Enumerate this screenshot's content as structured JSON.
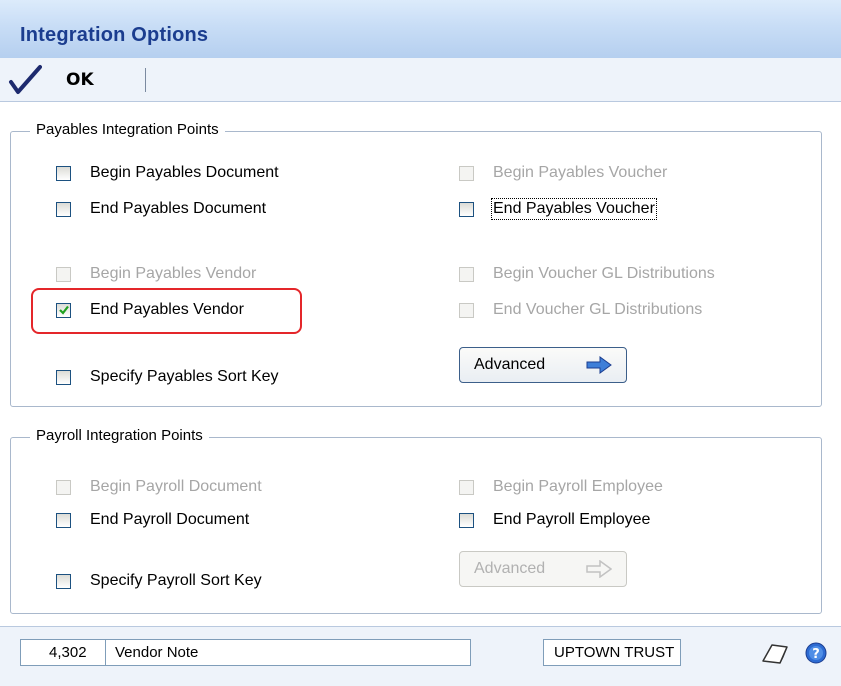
{
  "window": {
    "title": "Integration Options"
  },
  "toolbar": {
    "ok_label": "OK"
  },
  "payables": {
    "group_title": "Payables Integration Points",
    "items": [
      {
        "label": "Begin Payables Document",
        "checked": false,
        "enabled": true
      },
      {
        "label": "End Payables Document",
        "checked": false,
        "enabled": true
      },
      {
        "label": "Begin Payables Vendor",
        "checked": false,
        "enabled": false
      },
      {
        "label": "End Payables Vendor",
        "checked": true,
        "enabled": true
      },
      {
        "label": "Specify Payables Sort Key",
        "checked": false,
        "enabled": true
      },
      {
        "label": "Begin Payables Voucher",
        "checked": false,
        "enabled": false
      },
      {
        "label": "End Payables Voucher",
        "checked": false,
        "enabled": true
      },
      {
        "label": "Begin Voucher GL Distributions",
        "checked": false,
        "enabled": false
      },
      {
        "label": "End Voucher GL Distributions",
        "checked": false,
        "enabled": false
      }
    ],
    "advanced_label": "Advanced"
  },
  "payroll": {
    "group_title": "Payroll Integration Points",
    "items": [
      {
        "label": "Begin Payroll Document",
        "checked": false,
        "enabled": false
      },
      {
        "label": "End Payroll Document",
        "checked": false,
        "enabled": true
      },
      {
        "label": "Specify Payroll Sort Key",
        "checked": false,
        "enabled": true
      },
      {
        "label": "Begin Payroll Employee",
        "checked": false,
        "enabled": false
      },
      {
        "label": "End Payroll Employee",
        "checked": false,
        "enabled": true
      }
    ],
    "advanced_label": "Advanced"
  },
  "status": {
    "record_number": "4,302",
    "record_name": "Vendor Note",
    "company": "UPTOWN TRUST"
  },
  "colors": {
    "title_text": "#1b3d8f",
    "highlight": "#e4262a",
    "checkbox_border": "#1c5180",
    "disabled_text": "#a6a6a6",
    "arrow_blue": "#3e7fd8"
  }
}
